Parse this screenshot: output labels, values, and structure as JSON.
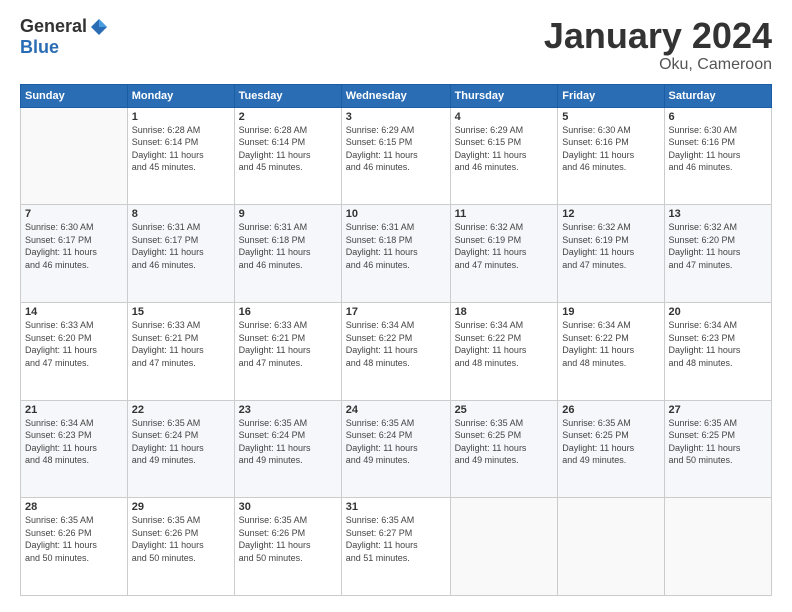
{
  "logo": {
    "general": "General",
    "blue": "Blue"
  },
  "title": {
    "month_year": "January 2024",
    "location": "Oku, Cameroon"
  },
  "days_of_week": [
    "Sunday",
    "Monday",
    "Tuesday",
    "Wednesday",
    "Thursday",
    "Friday",
    "Saturday"
  ],
  "weeks": [
    [
      {
        "day": "",
        "info": ""
      },
      {
        "day": "1",
        "info": "Sunrise: 6:28 AM\nSunset: 6:14 PM\nDaylight: 11 hours\nand 45 minutes."
      },
      {
        "day": "2",
        "info": "Sunrise: 6:28 AM\nSunset: 6:14 PM\nDaylight: 11 hours\nand 45 minutes."
      },
      {
        "day": "3",
        "info": "Sunrise: 6:29 AM\nSunset: 6:15 PM\nDaylight: 11 hours\nand 46 minutes."
      },
      {
        "day": "4",
        "info": "Sunrise: 6:29 AM\nSunset: 6:15 PM\nDaylight: 11 hours\nand 46 minutes."
      },
      {
        "day": "5",
        "info": "Sunrise: 6:30 AM\nSunset: 6:16 PM\nDaylight: 11 hours\nand 46 minutes."
      },
      {
        "day": "6",
        "info": "Sunrise: 6:30 AM\nSunset: 6:16 PM\nDaylight: 11 hours\nand 46 minutes."
      }
    ],
    [
      {
        "day": "7",
        "info": "Sunrise: 6:30 AM\nSunset: 6:17 PM\nDaylight: 11 hours\nand 46 minutes."
      },
      {
        "day": "8",
        "info": "Sunrise: 6:31 AM\nSunset: 6:17 PM\nDaylight: 11 hours\nand 46 minutes."
      },
      {
        "day": "9",
        "info": "Sunrise: 6:31 AM\nSunset: 6:18 PM\nDaylight: 11 hours\nand 46 minutes."
      },
      {
        "day": "10",
        "info": "Sunrise: 6:31 AM\nSunset: 6:18 PM\nDaylight: 11 hours\nand 46 minutes."
      },
      {
        "day": "11",
        "info": "Sunrise: 6:32 AM\nSunset: 6:19 PM\nDaylight: 11 hours\nand 47 minutes."
      },
      {
        "day": "12",
        "info": "Sunrise: 6:32 AM\nSunset: 6:19 PM\nDaylight: 11 hours\nand 47 minutes."
      },
      {
        "day": "13",
        "info": "Sunrise: 6:32 AM\nSunset: 6:20 PM\nDaylight: 11 hours\nand 47 minutes."
      }
    ],
    [
      {
        "day": "14",
        "info": "Sunrise: 6:33 AM\nSunset: 6:20 PM\nDaylight: 11 hours\nand 47 minutes."
      },
      {
        "day": "15",
        "info": "Sunrise: 6:33 AM\nSunset: 6:21 PM\nDaylight: 11 hours\nand 47 minutes."
      },
      {
        "day": "16",
        "info": "Sunrise: 6:33 AM\nSunset: 6:21 PM\nDaylight: 11 hours\nand 47 minutes."
      },
      {
        "day": "17",
        "info": "Sunrise: 6:34 AM\nSunset: 6:22 PM\nDaylight: 11 hours\nand 48 minutes."
      },
      {
        "day": "18",
        "info": "Sunrise: 6:34 AM\nSunset: 6:22 PM\nDaylight: 11 hours\nand 48 minutes."
      },
      {
        "day": "19",
        "info": "Sunrise: 6:34 AM\nSunset: 6:22 PM\nDaylight: 11 hours\nand 48 minutes."
      },
      {
        "day": "20",
        "info": "Sunrise: 6:34 AM\nSunset: 6:23 PM\nDaylight: 11 hours\nand 48 minutes."
      }
    ],
    [
      {
        "day": "21",
        "info": "Sunrise: 6:34 AM\nSunset: 6:23 PM\nDaylight: 11 hours\nand 48 minutes."
      },
      {
        "day": "22",
        "info": "Sunrise: 6:35 AM\nSunset: 6:24 PM\nDaylight: 11 hours\nand 49 minutes."
      },
      {
        "day": "23",
        "info": "Sunrise: 6:35 AM\nSunset: 6:24 PM\nDaylight: 11 hours\nand 49 minutes."
      },
      {
        "day": "24",
        "info": "Sunrise: 6:35 AM\nSunset: 6:24 PM\nDaylight: 11 hours\nand 49 minutes."
      },
      {
        "day": "25",
        "info": "Sunrise: 6:35 AM\nSunset: 6:25 PM\nDaylight: 11 hours\nand 49 minutes."
      },
      {
        "day": "26",
        "info": "Sunrise: 6:35 AM\nSunset: 6:25 PM\nDaylight: 11 hours\nand 49 minutes."
      },
      {
        "day": "27",
        "info": "Sunrise: 6:35 AM\nSunset: 6:25 PM\nDaylight: 11 hours\nand 50 minutes."
      }
    ],
    [
      {
        "day": "28",
        "info": "Sunrise: 6:35 AM\nSunset: 6:26 PM\nDaylight: 11 hours\nand 50 minutes."
      },
      {
        "day": "29",
        "info": "Sunrise: 6:35 AM\nSunset: 6:26 PM\nDaylight: 11 hours\nand 50 minutes."
      },
      {
        "day": "30",
        "info": "Sunrise: 6:35 AM\nSunset: 6:26 PM\nDaylight: 11 hours\nand 50 minutes."
      },
      {
        "day": "31",
        "info": "Sunrise: 6:35 AM\nSunset: 6:27 PM\nDaylight: 11 hours\nand 51 minutes."
      },
      {
        "day": "",
        "info": ""
      },
      {
        "day": "",
        "info": ""
      },
      {
        "day": "",
        "info": ""
      }
    ]
  ]
}
